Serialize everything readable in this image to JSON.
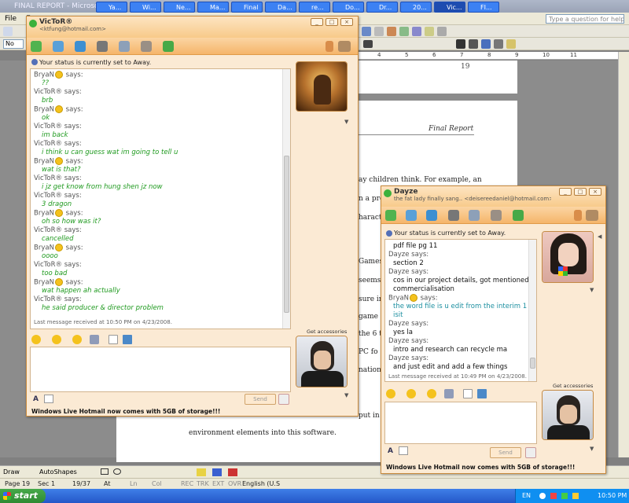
{
  "word": {
    "title": "FINAL REPORT - Microsoft Word",
    "menu": [
      "File",
      "E"
    ],
    "help_placeholder": "Type a question for help",
    "style_box": "No",
    "page_top_number": "19",
    "report_header": "Final Report",
    "doc_fragments": [
      "ay children think. For example, an",
      "n a pre",
      "haracte",
      "Games",
      "seems",
      "sure in",
      "game",
      "the 6 t",
      "PC fo",
      "nation",
      "put in"
    ],
    "doc_last_line": "environment elements into this software.",
    "draw_label": "Draw",
    "autoshapes_label": "AutoShapes",
    "status": {
      "page": "Page 19",
      "sec": "Sec 1",
      "pages": "19/37",
      "at": "At",
      "ln": "Ln",
      "col": "Col",
      "rec": "REC",
      "trk": "TRK",
      "ext": "EXT",
      "ovr": "OVR",
      "lang": "English (U.S"
    }
  },
  "taskbar": {
    "start": "start",
    "tasks": [
      "Ya...",
      "Wi...",
      "Ne...",
      "Ma...",
      "Final",
      "Da...",
      "re...",
      "Do...",
      "Dr...",
      "20...",
      "Vic...",
      "FI..."
    ],
    "lang": "EN",
    "clock": "10:50 PM"
  },
  "victor": {
    "name": "VicToR®",
    "email": "<ktfung@hotmail.com>",
    "status": "Your status is currently set to Away.",
    "messages": [
      {
        "who": "BryaN",
        "emo": true,
        "text": "??"
      },
      {
        "who": "VicToR®",
        "emo": false,
        "text": "brb"
      },
      {
        "who": "BryaN",
        "emo": true,
        "text": "ok"
      },
      {
        "who": "VicToR®",
        "emo": false,
        "text": "im back"
      },
      {
        "who": "VicToR®",
        "emo": false,
        "text": "i think u can guess wat im going to tell u"
      },
      {
        "who": "BryaN",
        "emo": true,
        "text": "wat is that?"
      },
      {
        "who": "VicToR®",
        "emo": false,
        "text": "i jz get know from hung shen jz now"
      },
      {
        "who": "VicToR®",
        "emo": false,
        "text": "3 dragon"
      },
      {
        "who": "BryaN",
        "emo": true,
        "text": "oh so how was it?"
      },
      {
        "who": "VicToR®",
        "emo": false,
        "text": "cancelled"
      },
      {
        "who": "BryaN",
        "emo": true,
        "text": "oooo"
      },
      {
        "who": "VicToR®",
        "emo": false,
        "text": "too bad"
      },
      {
        "who": "BryaN",
        "emo": true,
        "text": "wat happen ah actually"
      },
      {
        "who": "VicToR®",
        "emo": false,
        "text": "he said producer & director problem"
      }
    ],
    "says": "says:",
    "last_received": "Last message received at 10:50 PM on 4/23/2008.",
    "send": "Send",
    "get_accessories": "Get accessories",
    "ad": "Windows Live Hotmail now comes with 5GB of storage!!!"
  },
  "dayze": {
    "name": "Dayze",
    "subtitle": "the fat lady finally sang.. <deisereedaniel@hotmail.com>",
    "status": "Your status is currently set to Away.",
    "messages": [
      {
        "who": "",
        "emo": false,
        "text": "pdf file pg 11"
      },
      {
        "who": "Dayze",
        "emo": false,
        "text": "section 2"
      },
      {
        "who": "Dayze",
        "emo": false,
        "text": "cos in our project details, got mentioned"
      },
      {
        "who": "",
        "emo": false,
        "text": "commercialisation"
      },
      {
        "who": "BryaN",
        "emo": true,
        "text": "the word file is u edit from the interim 1"
      },
      {
        "who": "",
        "emo": false,
        "text": "isit"
      },
      {
        "who": "Dayze",
        "emo": false,
        "text": "yes la"
      },
      {
        "who": "Dayze",
        "emo": false,
        "text": "intro and research can recycle ma"
      },
      {
        "who": "Dayze",
        "emo": false,
        "text": "and just edit and add a few things"
      }
    ],
    "says": "says:",
    "last_received": "Last message received at 10:49 PM on 4/23/2008.",
    "send": "Send",
    "get_accessories": "Get accessories",
    "ad": "Windows Live Hotmail now comes with 5GB of storage!!!"
  },
  "colors": {
    "msgr_border": "#c98a3c",
    "self_text": "#1f9a1f",
    "self_text_blue": "#1c8fa0",
    "contact_text": "#111111"
  }
}
